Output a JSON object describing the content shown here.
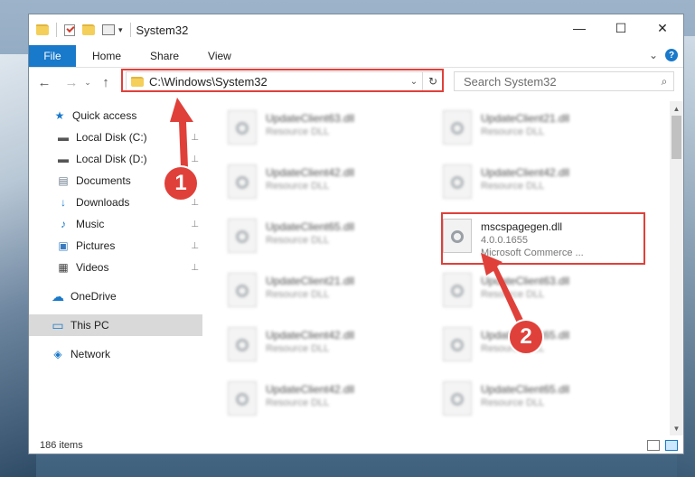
{
  "window": {
    "title": "System32"
  },
  "window_controls": {
    "minimize": "—",
    "maximize": "☐",
    "close": "✕"
  },
  "ribbon": {
    "file_tab": "File",
    "tabs": [
      "Home",
      "Share",
      "View"
    ],
    "expand": "⌄",
    "help": "?"
  },
  "nav_buttons": {
    "back": "←",
    "forward": "→",
    "recent": "⌄",
    "up": "↑"
  },
  "address": {
    "path": "C:\\Windows\\System32",
    "dropdown": "⌄",
    "refresh": "↻"
  },
  "search": {
    "placeholder": "Search System32",
    "icon": "⌕"
  },
  "sidebar": {
    "items": [
      {
        "label": "Quick access",
        "icon": "★"
      },
      {
        "label": "Local Disk (C:)",
        "icon": "▬"
      },
      {
        "label": "Local Disk (D:)",
        "icon": "▬"
      },
      {
        "label": "Documents",
        "icon": "▤"
      },
      {
        "label": "Downloads",
        "icon": "↓"
      },
      {
        "label": "Music",
        "icon": "♪"
      },
      {
        "label": "Pictures",
        "icon": "▣"
      },
      {
        "label": "Videos",
        "icon": "▦"
      },
      {
        "label": "OneDrive",
        "icon": "☁"
      },
      {
        "label": "This PC",
        "icon": "▭"
      },
      {
        "label": "Network",
        "icon": "◈"
      }
    ],
    "pin": "📌"
  },
  "files": [
    {
      "name": "UpdateClient63.dll",
      "type": "Resource DLL"
    },
    {
      "name": "UpdateClient21.dll",
      "type": "Resource DLL"
    },
    {
      "name": "UpdateClient42.dll",
      "type": "Resource DLL"
    },
    {
      "name": "UpdateClient42.dll",
      "type": "Resource DLL"
    },
    {
      "name": "UpdateClient65.dll",
      "type": "Resource DLL"
    },
    {
      "name": "mscspagegen.dll",
      "type": "4.0.0.1655",
      "desc": "Microsoft Commerce ..."
    },
    {
      "name": "UpdateClient21.dll",
      "type": "Resource DLL"
    },
    {
      "name": "UpdateClient63.dll",
      "type": "Resource DLL"
    },
    {
      "name": "UpdateClient42.dll",
      "type": "Resource DLL"
    },
    {
      "name": "UpdateClient65.dll",
      "type": "Resource DLL"
    },
    {
      "name": "UpdateClient42.dll",
      "type": "Resource DLL"
    },
    {
      "name": "UpdateClient65.dll",
      "type": "Resource DLL"
    }
  ],
  "scrollbar": {
    "up": "▲",
    "down": "▼"
  },
  "status": {
    "count": "186 items"
  },
  "annotations": {
    "badge1": "1",
    "badge2": "2",
    "color": "#e0403a"
  }
}
